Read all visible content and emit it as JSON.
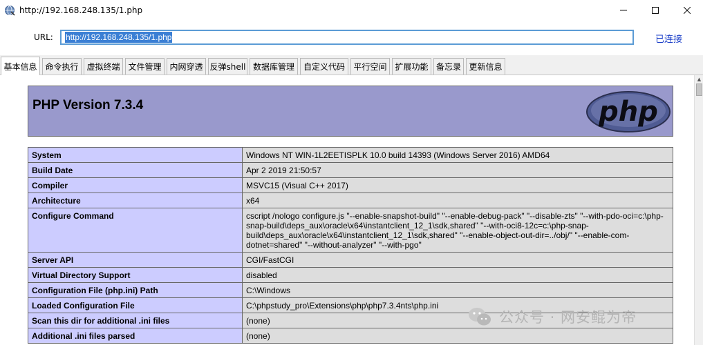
{
  "window": {
    "title": "http://192.168.248.135/1.php",
    "controls": {
      "minimize": "—",
      "maximize": "☐",
      "close": "✕"
    }
  },
  "urlbar": {
    "label": "URL:",
    "value": "http://192.168.248.135/1.php",
    "status": "已连接"
  },
  "tabs": [
    {
      "label": "基本信息",
      "active": true
    },
    {
      "label": "命令执行",
      "active": false
    },
    {
      "label": "虚拟终端",
      "active": false
    },
    {
      "label": "文件管理",
      "active": false
    },
    {
      "label": "内网穿透",
      "active": false
    },
    {
      "label": "反弹shell",
      "active": false
    },
    {
      "label": "数据库管理",
      "active": false
    },
    {
      "label": "自定义代码",
      "active": false
    },
    {
      "label": "平行空间",
      "active": false
    },
    {
      "label": "扩展功能",
      "active": false
    },
    {
      "label": "备忘录",
      "active": false
    },
    {
      "label": "更新信息",
      "active": false
    }
  ],
  "phpinfo": {
    "version_title": "PHP Version 7.3.4",
    "logo_text": "php",
    "header_color": "#9999cc",
    "rows": [
      {
        "key": "System",
        "value": "Windows NT WIN-1L2EETISPLK 10.0 build 14393 (Windows Server 2016) AMD64"
      },
      {
        "key": "Build Date",
        "value": "Apr 2 2019 21:50:57"
      },
      {
        "key": "Compiler",
        "value": "MSVC15 (Visual C++ 2017)"
      },
      {
        "key": "Architecture",
        "value": "x64"
      },
      {
        "key": "Configure Command",
        "value": "cscript /nologo configure.js \"--enable-snapshot-build\" \"--enable-debug-pack\" \"--disable-zts\" \"--with-pdo-oci=c:\\php-snap-build\\deps_aux\\oracle\\x64\\instantclient_12_1\\sdk,shared\" \"--with-oci8-12c=c:\\php-snap-build\\deps_aux\\oracle\\x64\\instantclient_12_1\\sdk,shared\" \"--enable-object-out-dir=../obj/\" \"--enable-com-dotnet=shared\" \"--without-analyzer\" \"--with-pgo\""
      },
      {
        "key": "Server API",
        "value": "CGI/FastCGI"
      },
      {
        "key": "Virtual Directory Support",
        "value": "disabled"
      },
      {
        "key": "Configuration File (php.ini) Path",
        "value": "C:\\Windows"
      },
      {
        "key": "Loaded Configuration File",
        "value": "C:\\phpstudy_pro\\Extensions\\php\\php7.3.4nts\\php.ini"
      },
      {
        "key": "Scan this dir for additional .ini files",
        "value": "(none)"
      },
      {
        "key": "Additional .ini files parsed",
        "value": "(none)"
      }
    ]
  },
  "watermark": {
    "text": "公众号 · 网安鲲为帝",
    "icon": "wechat-icon"
  }
}
